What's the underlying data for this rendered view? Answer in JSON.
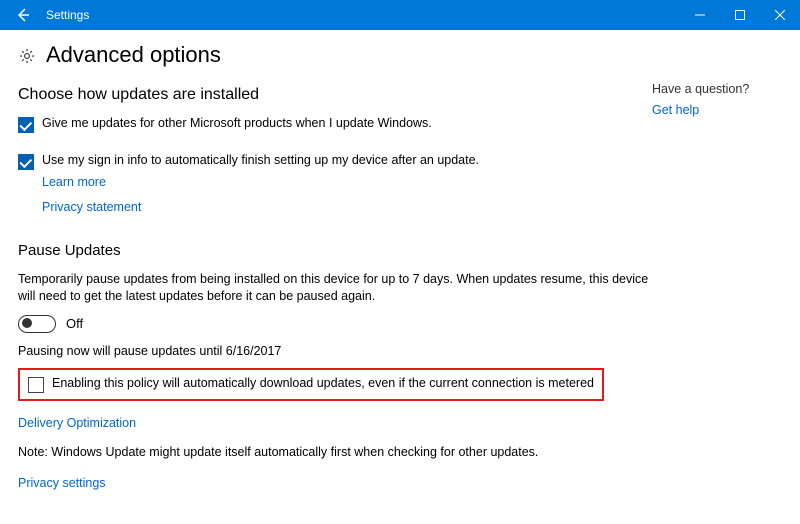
{
  "titlebar": {
    "app_name": "Settings"
  },
  "header": {
    "title": "Advanced options"
  },
  "section_install": {
    "heading": "Choose how updates are installed",
    "checkbox_other_products": {
      "label": "Give me updates for other Microsoft products when I update Windows.",
      "checked": true
    },
    "checkbox_signin_finish": {
      "label": "Use my sign in info to automatically finish setting up my device after an update.",
      "checked": true
    },
    "link_learn_more": "Learn more",
    "link_privacy_statement": "Privacy statement"
  },
  "section_pause": {
    "heading": "Pause Updates",
    "description": "Temporarily pause updates from being installed on this device for up to 7 days. When updates resume, this device will need to get the latest updates before it can be paused again.",
    "toggle": {
      "state": "Off",
      "on": false
    },
    "pause_until_text": "Pausing now will pause updates until 6/16/2017"
  },
  "highlighted_checkbox": {
    "label": "Enabling this policy will automatically download updates, even if the current connection is metered",
    "checked": false
  },
  "links": {
    "delivery_optimization": "Delivery Optimization",
    "privacy_settings": "Privacy settings"
  },
  "note_text": "Note: Windows Update might update itself automatically first when checking for other updates.",
  "side": {
    "heading": "Have a question?",
    "get_help_link": "Get help"
  }
}
